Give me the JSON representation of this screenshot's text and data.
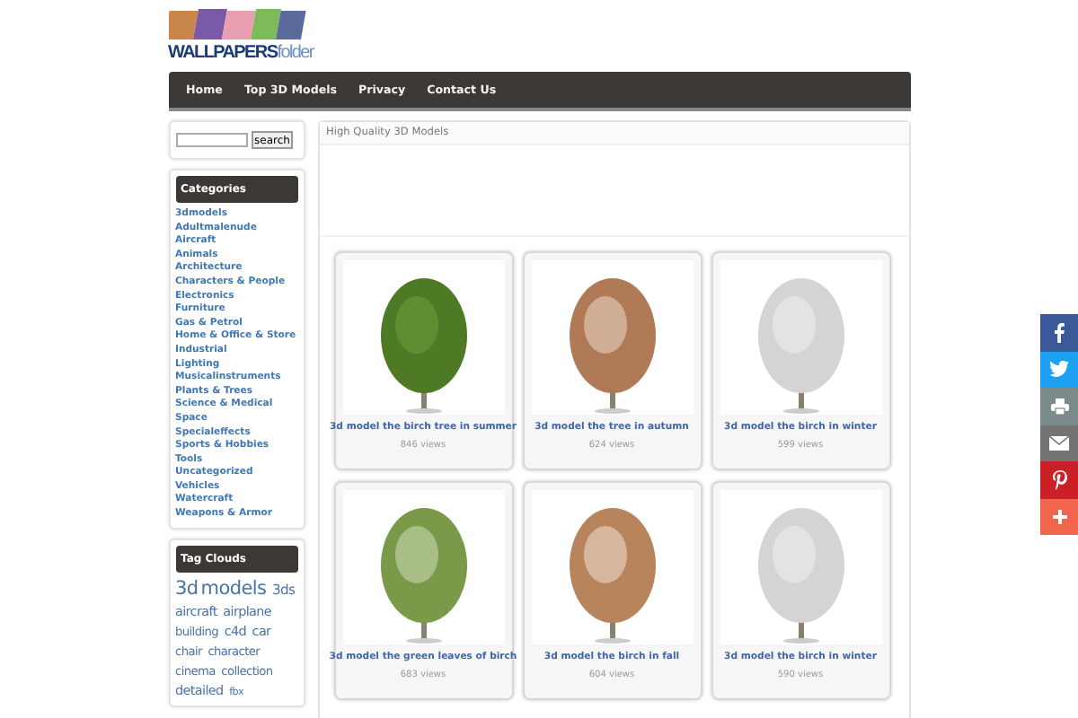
{
  "logo": {
    "text": "**WALLPAPERS**folder"
  },
  "nav": [
    {
      "label": "Home"
    },
    {
      "label": "Top 3D Models"
    },
    {
      "label": "Privacy"
    },
    {
      "label": "Contact Us"
    }
  ],
  "search": {
    "button": "search"
  },
  "categories": {
    "title": "Categories",
    "items": [
      "3dmodels",
      "Adultmalenude",
      "Aircraft",
      "Animals",
      "Architecture",
      "Characters & People",
      "Electronics",
      "Furniture",
      "Gas & Petrol",
      "Home & Office & Store",
      "Industrial",
      "Lighting",
      "Musicalinstruments",
      "Plants & Trees",
      "Science & Medical",
      "Space",
      "Specialeffects",
      "Sports & Hobbies",
      "Tools",
      "Uncategorized",
      "Vehicles",
      "Watercraft",
      "Weapons & Armor"
    ]
  },
  "tag_clouds": {
    "title": "Tag Clouds",
    "tags": [
      {
        "label": "3d models",
        "kind": "xl"
      },
      {
        "label": "3ds",
        "kind": "large"
      },
      {
        "label": "aircraft",
        "kind": "medium"
      },
      {
        "label": "airplane",
        "kind": "medium"
      },
      {
        "label": "building",
        "kind": "small"
      },
      {
        "label": "c4d",
        "kind": "medium"
      },
      {
        "label": "car",
        "kind": "medium"
      },
      {
        "label": "chair",
        "kind": "small"
      },
      {
        "label": "character",
        "kind": "small"
      },
      {
        "label": "cinema",
        "kind": "small"
      },
      {
        "label": "collection",
        "kind": "small"
      },
      {
        "label": "detailed",
        "kind": "medium"
      },
      {
        "label": "fbx",
        "kind": "tiny"
      }
    ]
  },
  "main": {
    "heading": "High Quality 3D Models",
    "cards": [
      {
        "title": "3d model the birch tree in summer",
        "views": "846 views",
        "kind": "summer"
      },
      {
        "title": "3d model the tree in autumn",
        "views": "624 views",
        "kind": "autumn"
      },
      {
        "title": "3d model the birch in winter",
        "views": "599 views",
        "kind": "winter"
      },
      {
        "title": "3d model the green leaves of birch",
        "views": "683 views",
        "kind": "spring"
      },
      {
        "title": "3d model the birch in fall",
        "views": "604 views",
        "kind": "fall"
      },
      {
        "title": "3d model the birch in winter",
        "views": "590 views",
        "kind": "winter"
      }
    ]
  },
  "share": [
    {
      "kind": "facebook"
    },
    {
      "kind": "twitter"
    },
    {
      "kind": "print"
    },
    {
      "kind": "email"
    },
    {
      "kind": "pinterest"
    },
    {
      "kind": "more"
    }
  ]
}
